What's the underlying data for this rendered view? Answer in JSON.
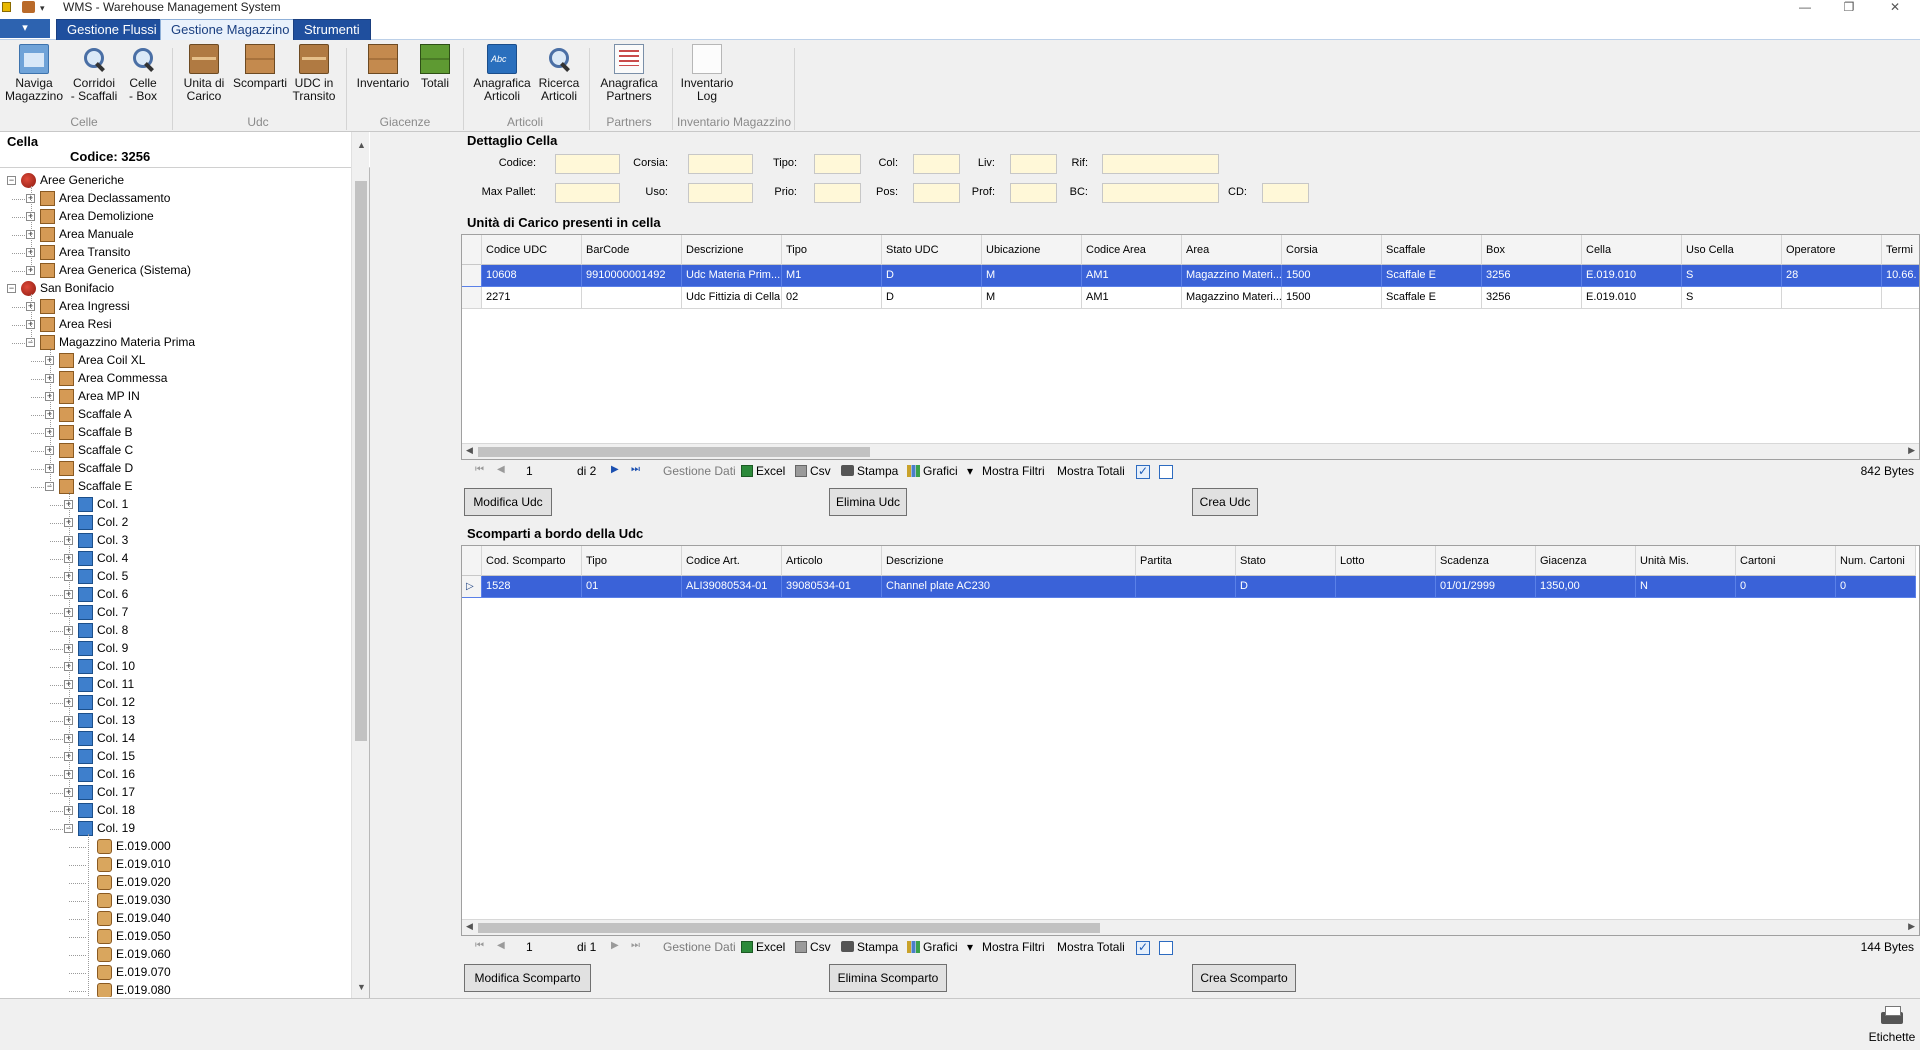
{
  "window": {
    "title": "WMS - Warehouse Management System",
    "minimize": "—",
    "restore": "❐",
    "close": "✕"
  },
  "quick_access": {
    "menu_glyph": "▾"
  },
  "ribbon_tabs": {
    "file": "▾",
    "tabs": [
      "Gestione Flussi",
      "Gestione Magazzino",
      "Strumenti"
    ],
    "selected": "Gestione Magazzino"
  },
  "ribbon": {
    "buttons": [
      {
        "label1": "Naviga",
        "label2": "Magazzino",
        "icon": "navigate-warehouse-icon"
      },
      {
        "label1": "Corridoi",
        "label2": "- Scaffali",
        "icon": "magnifier-icon"
      },
      {
        "label1": "Celle",
        "label2": "- Box",
        "icon": "magnifier-icon"
      },
      {
        "label1": "Unita di",
        "label2": "Carico",
        "icon": "cardboard-box-icon"
      },
      {
        "label1": "Scomparti",
        "label2": "",
        "icon": "boxes-icon"
      },
      {
        "label1": "UDC in",
        "label2": "Transito",
        "icon": "forklift-icon"
      },
      {
        "label1": "Inventario",
        "label2": "",
        "icon": "stacked-boxes-icon"
      },
      {
        "label1": "Totali",
        "label2": "",
        "icon": "green-boxes-icon"
      },
      {
        "label1": "Anagrafica",
        "label2": "Articoli",
        "icon": "book-abc-icon"
      },
      {
        "label1": "Ricerca",
        "label2": "Articoli",
        "icon": "search-articles-icon"
      },
      {
        "label1": "Anagrafica",
        "label2": "Partners",
        "icon": "partners-doc-icon"
      },
      {
        "label1": "Inventario",
        "label2": "Log",
        "icon": "log-icon"
      }
    ],
    "groups": [
      "Celle",
      "Udc",
      "Giacenze",
      "Articoli",
      "Partners",
      "Inventario Magazzino"
    ]
  },
  "left": {
    "title": "Cella",
    "code_label": "Codice: 3256",
    "tree": [
      {
        "label": "Aree Generiche",
        "level": 0,
        "icon": "globe",
        "exp": "-"
      },
      {
        "label": "Area Declassamento",
        "level": 1,
        "icon": "box",
        "exp": "+"
      },
      {
        "label": "Area Demolizione",
        "level": 1,
        "icon": "box",
        "exp": "+"
      },
      {
        "label": "Area Manuale",
        "level": 1,
        "icon": "box",
        "exp": "+"
      },
      {
        "label": "Area Transito",
        "level": 1,
        "icon": "box",
        "exp": "+"
      },
      {
        "label": "Area Generica (Sistema)",
        "level": 1,
        "icon": "box",
        "exp": "+"
      },
      {
        "label": "San Bonifacio",
        "level": 0,
        "icon": "globe",
        "exp": "-"
      },
      {
        "label": "Area Ingressi",
        "level": 1,
        "icon": "box",
        "exp": "+"
      },
      {
        "label": "Area Resi",
        "level": 1,
        "icon": "box",
        "exp": "+"
      },
      {
        "label": "Magazzino Materia Prima",
        "level": 1,
        "icon": "box",
        "exp": "-"
      },
      {
        "label": "Area Coil XL",
        "level": 2,
        "icon": "box",
        "exp": "+"
      },
      {
        "label": "Area Commessa",
        "level": 2,
        "icon": "box",
        "exp": "+"
      },
      {
        "label": "Area MP IN",
        "level": 2,
        "icon": "box",
        "exp": "+"
      },
      {
        "label": "Scaffale A",
        "level": 2,
        "icon": "box",
        "exp": "+"
      },
      {
        "label": "Scaffale B",
        "level": 2,
        "icon": "box",
        "exp": "+"
      },
      {
        "label": "Scaffale C",
        "level": 2,
        "icon": "box",
        "exp": "+"
      },
      {
        "label": "Scaffale D",
        "level": 2,
        "icon": "box",
        "exp": "+"
      },
      {
        "label": "Scaffale E",
        "level": 2,
        "icon": "box",
        "exp": "-"
      },
      {
        "label": "Col. 1",
        "level": 3,
        "icon": "blue",
        "exp": "+"
      },
      {
        "label": "Col. 2",
        "level": 3,
        "icon": "blue",
        "exp": "+"
      },
      {
        "label": "Col. 3",
        "level": 3,
        "icon": "blue",
        "exp": "+"
      },
      {
        "label": "Col. 4",
        "level": 3,
        "icon": "blue",
        "exp": "+"
      },
      {
        "label": "Col. 5",
        "level": 3,
        "icon": "blue",
        "exp": "+"
      },
      {
        "label": "Col. 6",
        "level": 3,
        "icon": "blue",
        "exp": "+"
      },
      {
        "label": "Col. 7",
        "level": 3,
        "icon": "blue",
        "exp": "+"
      },
      {
        "label": "Col. 8",
        "level": 3,
        "icon": "blue",
        "exp": "+"
      },
      {
        "label": "Col. 9",
        "level": 3,
        "icon": "blue",
        "exp": "+"
      },
      {
        "label": "Col. 10",
        "level": 3,
        "icon": "blue",
        "exp": "+"
      },
      {
        "label": "Col. 11",
        "level": 3,
        "icon": "blue",
        "exp": "+"
      },
      {
        "label": "Col. 12",
        "level": 3,
        "icon": "blue",
        "exp": "+"
      },
      {
        "label": "Col. 13",
        "level": 3,
        "icon": "blue",
        "exp": "+"
      },
      {
        "label": "Col. 14",
        "level": 3,
        "icon": "blue",
        "exp": "+"
      },
      {
        "label": "Col. 15",
        "level": 3,
        "icon": "blue",
        "exp": "+"
      },
      {
        "label": "Col. 16",
        "level": 3,
        "icon": "blue",
        "exp": "+"
      },
      {
        "label": "Col. 17",
        "level": 3,
        "icon": "blue",
        "exp": "+"
      },
      {
        "label": "Col. 18",
        "level": 3,
        "icon": "blue",
        "exp": "+"
      },
      {
        "label": "Col. 19",
        "level": 3,
        "icon": "blue",
        "exp": "-"
      },
      {
        "label": "E.019.000",
        "level": 4,
        "icon": "cell",
        "exp": ""
      },
      {
        "label": "E.019.010",
        "level": 4,
        "icon": "cell",
        "exp": ""
      },
      {
        "label": "E.019.020",
        "level": 4,
        "icon": "cell",
        "exp": ""
      },
      {
        "label": "E.019.030",
        "level": 4,
        "icon": "cell",
        "exp": ""
      },
      {
        "label": "E.019.040",
        "level": 4,
        "icon": "cell",
        "exp": ""
      },
      {
        "label": "E.019.050",
        "level": 4,
        "icon": "cell",
        "exp": ""
      },
      {
        "label": "E.019.060",
        "level": 4,
        "icon": "cell",
        "exp": ""
      },
      {
        "label": "E.019.070",
        "level": 4,
        "icon": "cell",
        "exp": ""
      },
      {
        "label": "E.019.080",
        "level": 4,
        "icon": "cell",
        "exp": ""
      }
    ]
  },
  "detail": {
    "title": "Dettaglio Cella",
    "labels": {
      "codice": "Codice:",
      "corsia": "Corsia:",
      "tipo": "Tipo:",
      "col": "Col:",
      "liv": "Liv:",
      "rif": "Rif:",
      "max_pallet": "Max Pallet:",
      "uso": "Uso:",
      "prio": "Prio:",
      "pos": "Pos:",
      "prof": "Prof:",
      "bc": "BC:",
      "cd": "CD:"
    },
    "values": {
      "codice": "",
      "corsia": "",
      "tipo": "",
      "col": "",
      "liv": "",
      "rif": "",
      "max_pallet": "",
      "uso": "",
      "prio": "",
      "pos": "",
      "prof": "",
      "bc": "",
      "cd": ""
    }
  },
  "udc": {
    "title": "Unità di Carico presenti in cella",
    "columns": [
      "Codice UDC",
      "BarCode",
      "Descrizione",
      "Tipo",
      "Stato UDC",
      "Ubicazione",
      "Codice Area",
      "Area",
      "Corsia",
      "Scaffale",
      "Box",
      "Cella",
      "Uso Cella",
      "Operatore",
      "Termi"
    ],
    "rows": [
      [
        "10608",
        "9910000001492",
        "Udc Materia Prim...",
        "M1",
        "D",
        "M",
        "AM1",
        "Magazzino Materi...",
        "1500",
        "Scaffale E",
        "3256",
        "E.019.010",
        "S",
        "28",
        "10.66."
      ],
      [
        "2271",
        "",
        "Udc Fittizia di Cella",
        "02",
        "D",
        "M",
        "AM1",
        "Magazzino Materi...",
        "1500",
        "Scaffale E",
        "3256",
        "E.019.010",
        "S",
        "",
        ""
      ]
    ],
    "pager": {
      "page": "1",
      "of": "di 2",
      "gestione": "Gestione Dati",
      "excel": "Excel",
      "csv": "Csv",
      "stampa": "Stampa",
      "grafici": "Grafici",
      "dropdown": "▾",
      "filtri": "Mostra Filtri",
      "totali": "Mostra Totali",
      "bytes": "842 Bytes"
    },
    "buttons": [
      "Modifica Udc",
      "Elimina Udc",
      "Crea Udc"
    ]
  },
  "scomparti": {
    "title": "Scomparti a bordo della Udc",
    "columns": [
      "Cod. Scomparto",
      "Tipo",
      "Codice Art.",
      "Articolo",
      "Descrizione",
      "Partita",
      "Stato",
      "Lotto",
      "Scadenza",
      "Giacenza",
      "Unità Mis.",
      "Cartoni",
      "Num. Cartoni"
    ],
    "rows": [
      [
        "1528",
        "01",
        "ALI39080534-01",
        "39080534-01",
        "Channel plate AC230",
        "",
        "D",
        "",
        "01/01/2999",
        "1350,00",
        "N",
        "0",
        "0"
      ]
    ],
    "pager": {
      "page": "1",
      "of": "di 1",
      "gestione": "Gestione Dati",
      "excel": "Excel",
      "csv": "Csv",
      "stampa": "Stampa",
      "grafici": "Grafici",
      "dropdown": "▾",
      "filtri": "Mostra Filtri",
      "totali": "Mostra Totali",
      "bytes": "144 Bytes"
    },
    "buttons": [
      "Modifica Scomparto",
      "Elimina Scomparto",
      "Crea Scomparto"
    ]
  },
  "status": {
    "etichette": "Etichette"
  },
  "colors": {
    "ribbon_tab": "#1f4f9e",
    "selection": "#3a62d8",
    "field_bg": "#fff8d8"
  }
}
